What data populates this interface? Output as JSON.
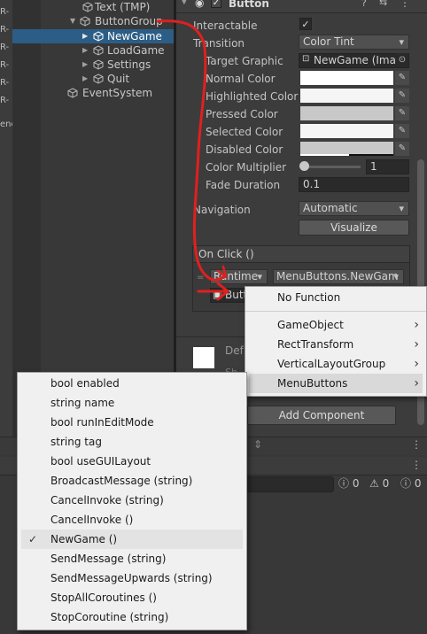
{
  "left_strip": {
    "items": [
      "R-",
      "R-",
      "R-",
      "R-",
      "R-",
      "R-",
      "ene"
    ]
  },
  "hierarchy": {
    "items": [
      {
        "label": "Text (TMP)"
      },
      {
        "label": "ButtonGroup"
      },
      {
        "label": "NewGame"
      },
      {
        "label": "LoadGame"
      },
      {
        "label": "Settings"
      },
      {
        "label": "Quit"
      },
      {
        "label": "EventSystem"
      }
    ]
  },
  "inspector": {
    "component_title": "Button",
    "interactable_label": "Interactable",
    "interactable_checked": true,
    "transition_label": "Transition",
    "transition_value": "Color Tint",
    "target_graphic_label": "Target Graphic",
    "target_graphic_value": "NewGame (Imag",
    "normal_color_label": "Normal Color",
    "highlighted_color_label": "Highlighted Color",
    "pressed_color_label": "Pressed Color",
    "selected_color_label": "Selected Color",
    "disabled_color_label": "Disabled Color",
    "color_multiplier_label": "Color Multiplier",
    "color_multiplier_value": "1",
    "fade_duration_label": "Fade Duration",
    "fade_duration_value": "0.1",
    "navigation_label": "Navigation",
    "navigation_value": "Automatic",
    "visualize_label": "Visualize",
    "onclick_label": "On Click ()",
    "runtime_value": "Runtime",
    "function_value": "MenuButtons.NewGam",
    "object_value": "Butt",
    "defaults_label": "Def",
    "defaults_sub": "Sh",
    "add_component_label": "Add Component",
    "colors": {
      "normal": "#ffffff",
      "highlighted": "#f5f5f5",
      "pressed": "#c8c8c8",
      "selected": "#f5f5f5",
      "disabled": "#c8c8c8"
    }
  },
  "console": {
    "info_count": "0",
    "warn_count": "0",
    "error_count": "0"
  },
  "popup_top": {
    "items": [
      {
        "label": "No Function",
        "arrow": false
      },
      {
        "label": "GameObject",
        "arrow": true
      },
      {
        "label": "RectTransform",
        "arrow": true
      },
      {
        "label": "VerticalLayoutGroup",
        "arrow": true
      },
      {
        "label": "MenuButtons",
        "arrow": true
      }
    ]
  },
  "popup_bottom": {
    "items": [
      "bool enabled",
      "string name",
      "bool runInEditMode",
      "string tag",
      "bool useGUILayout",
      "BroadcastMessage (string)",
      "CancelInvoke (string)",
      "CancelInvoke ()",
      "NewGame ()",
      "SendMessage (string)",
      "SendMessageUpwards (string)",
      "StopAllCoroutines ()",
      "StopCoroutine (string)"
    ],
    "selected_index": 8
  },
  "annotation_color": "#e0201e"
}
